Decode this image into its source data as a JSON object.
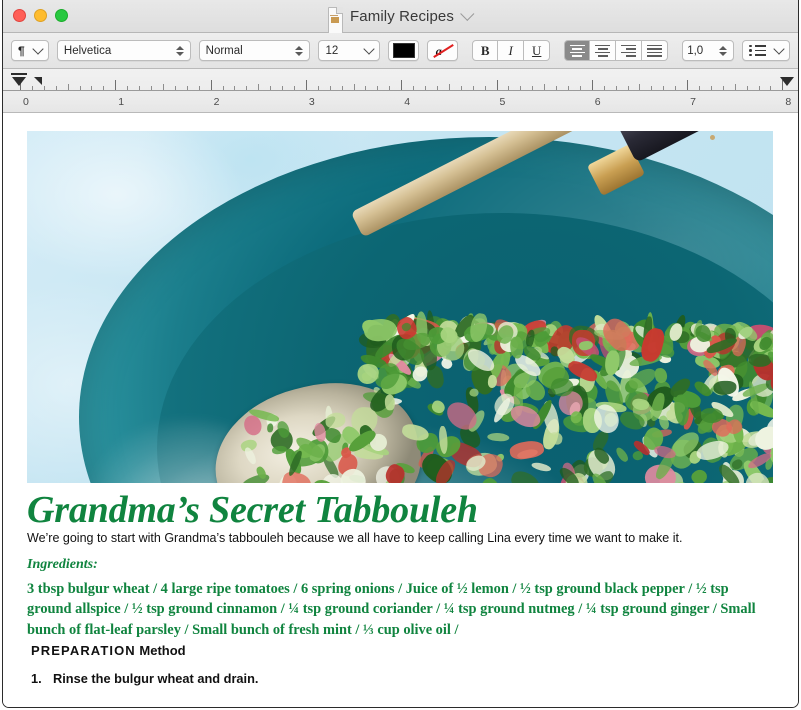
{
  "window": {
    "title": "Family Recipes",
    "doc_icon": "document-icon",
    "title_chevron": "chevron-down-icon",
    "traffic": {
      "close": "close-button",
      "minimize": "minimize-button",
      "zoom": "zoom-button",
      "close_color": "#ff5f57",
      "minimize_color": "#febc2e",
      "zoom_color": "#28c840"
    }
  },
  "toolbar": {
    "paragraph_style_icon": "pilcrow-icon",
    "paragraph_style_value": "¶",
    "font_family": "Helvetica",
    "font_style": "Normal",
    "font_size": "12",
    "text_color": "#000000",
    "text_color_name": "text-color-swatch",
    "remove_highlight_icon": "remove-highlight-icon",
    "bold": "B",
    "italic": "I",
    "underline": "U",
    "align_left": "align-left",
    "align_center": "align-center",
    "align_right": "align-right",
    "align_justify": "align-justify",
    "align_selected": "align-left",
    "line_spacing": "1,0",
    "list_icon": "bullet-list-icon"
  },
  "ruler": {
    "unit_labels": [
      "0",
      "1",
      "2",
      "3",
      "4",
      "5",
      "6",
      "7",
      "8"
    ],
    "left_indent_marker": "left-indent-marker",
    "first_line_indent_marker": "first-line-indent-marker",
    "right_indent_marker": "right-indent-marker"
  },
  "document": {
    "image_alt": "tabbouleh-salad-in-teal-bowl-photo",
    "title": "Grandma’s Secret Tabbouleh",
    "intro": "We’re going to start with Grandma’s tabbouleh because we all have to keep calling Lina every time we want to make it.",
    "ingredients_heading": "Ingredients:",
    "ingredients_body": "3 tbsp bulgur wheat / 4 large ripe tomatoes / 6 spring onions / Juice of ½ lemon / ½ tsp ground black pepper / ½ tsp ground allspice /  ½ tsp ground cinnamon / ¼ tsp ground coriander / ¼ tsp ground nutmeg / ¼ tsp ground ginger / Small bunch of flat-leaf parsley / Small bunch of fresh mint / ⅓ cup olive oil /",
    "preparation_heading_caps": "PREPARATION",
    "preparation_heading_rest": " Method",
    "steps": [
      {
        "num": "1.",
        "text": "Rinse the bulgur wheat and drain."
      }
    ],
    "accent_green": "#10843f"
  }
}
